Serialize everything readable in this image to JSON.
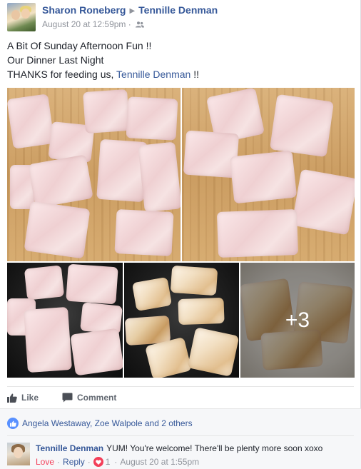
{
  "post": {
    "author": "Sharon Roneberg",
    "target": "Tennille Denman",
    "timestamp": "August 20 at 12:59pm",
    "separator": "·",
    "audience_icon": "friends-icon",
    "text_line1": "A Bit Of Sunday Afternoon Fun !!",
    "text_line2": "Our Dinner Last Night",
    "text_line3_prefix": "THANKS for feeding us,",
    "text_line3_link": "Tennille Denman",
    "text_line3_suffix": "!!"
  },
  "photos": {
    "more_count": "+3"
  },
  "actions": {
    "like": "Like",
    "comment": "Comment"
  },
  "reactions": {
    "icon": "like-icon",
    "people": "Angela Westaway, Zoe Walpole and 2 others"
  },
  "comment": {
    "author": "Tennille Denman",
    "text": "YUM! You're welcome! There'll be plenty more soon xoxo",
    "love": "Love",
    "reply": "Reply",
    "reaction_count": "1",
    "timestamp": "August 20 at 1:55pm",
    "dot": "·"
  },
  "colors": {
    "link": "#365899",
    "meta": "#90949c",
    "like_blue": "#5890ff",
    "love_red": "#f33e58"
  }
}
